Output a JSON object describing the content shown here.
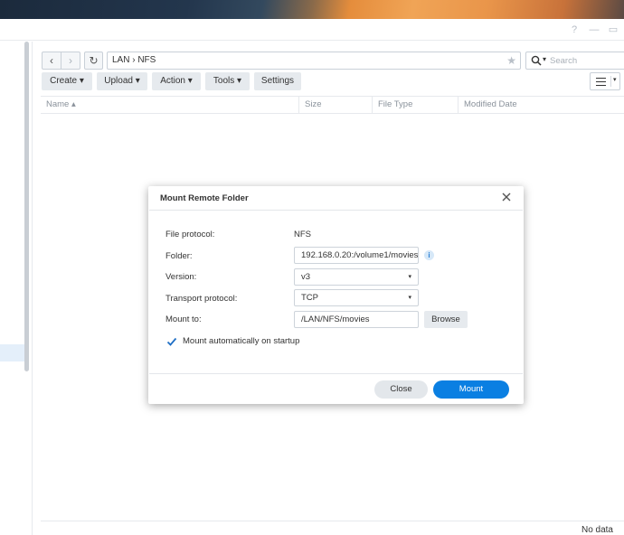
{
  "titlebar": {
    "help_glyph": "?",
    "minimize_glyph": "—",
    "maximize_glyph": "▭"
  },
  "navigation": {
    "back_glyph": "‹",
    "forward_glyph": "›",
    "refresh_glyph": "↻"
  },
  "path": {
    "text": "LAN › NFS",
    "star_glyph": "★"
  },
  "search": {
    "placeholder": "Search",
    "caret": "▾"
  },
  "toolbar": {
    "create_label": "Create ▾",
    "upload_label": "Upload ▾",
    "action_label": "Action ▾",
    "tools_label": "Tools ▾",
    "settings_label": "Settings",
    "view_caret": "▾"
  },
  "list": {
    "columns": [
      "Name ▴",
      "Size",
      "File Type",
      "Modified Date"
    ]
  },
  "status": {
    "text": "No data"
  },
  "dialog": {
    "title": "Mount Remote Folder",
    "file_protocol_label": "File protocol:",
    "file_protocol_value": "NFS",
    "folder_label": "Folder:",
    "folder_value": "192.168.0.20:/volume1/movies",
    "info_glyph": "i",
    "version_label": "Version:",
    "version_value": "v3",
    "transport_label": "Transport protocol:",
    "transport_value": "TCP",
    "mount_to_label": "Mount to:",
    "mount_to_value": "/LAN/NFS/movies",
    "browse_label": "Browse",
    "auto_mount_label": "Mount automatically on startup",
    "auto_mount_checked": true,
    "close_label": "Close",
    "mount_label": "Mount",
    "select_caret": "▾"
  },
  "colors": {
    "accent": "#0a7fe2",
    "check": "#1f6fc5"
  }
}
